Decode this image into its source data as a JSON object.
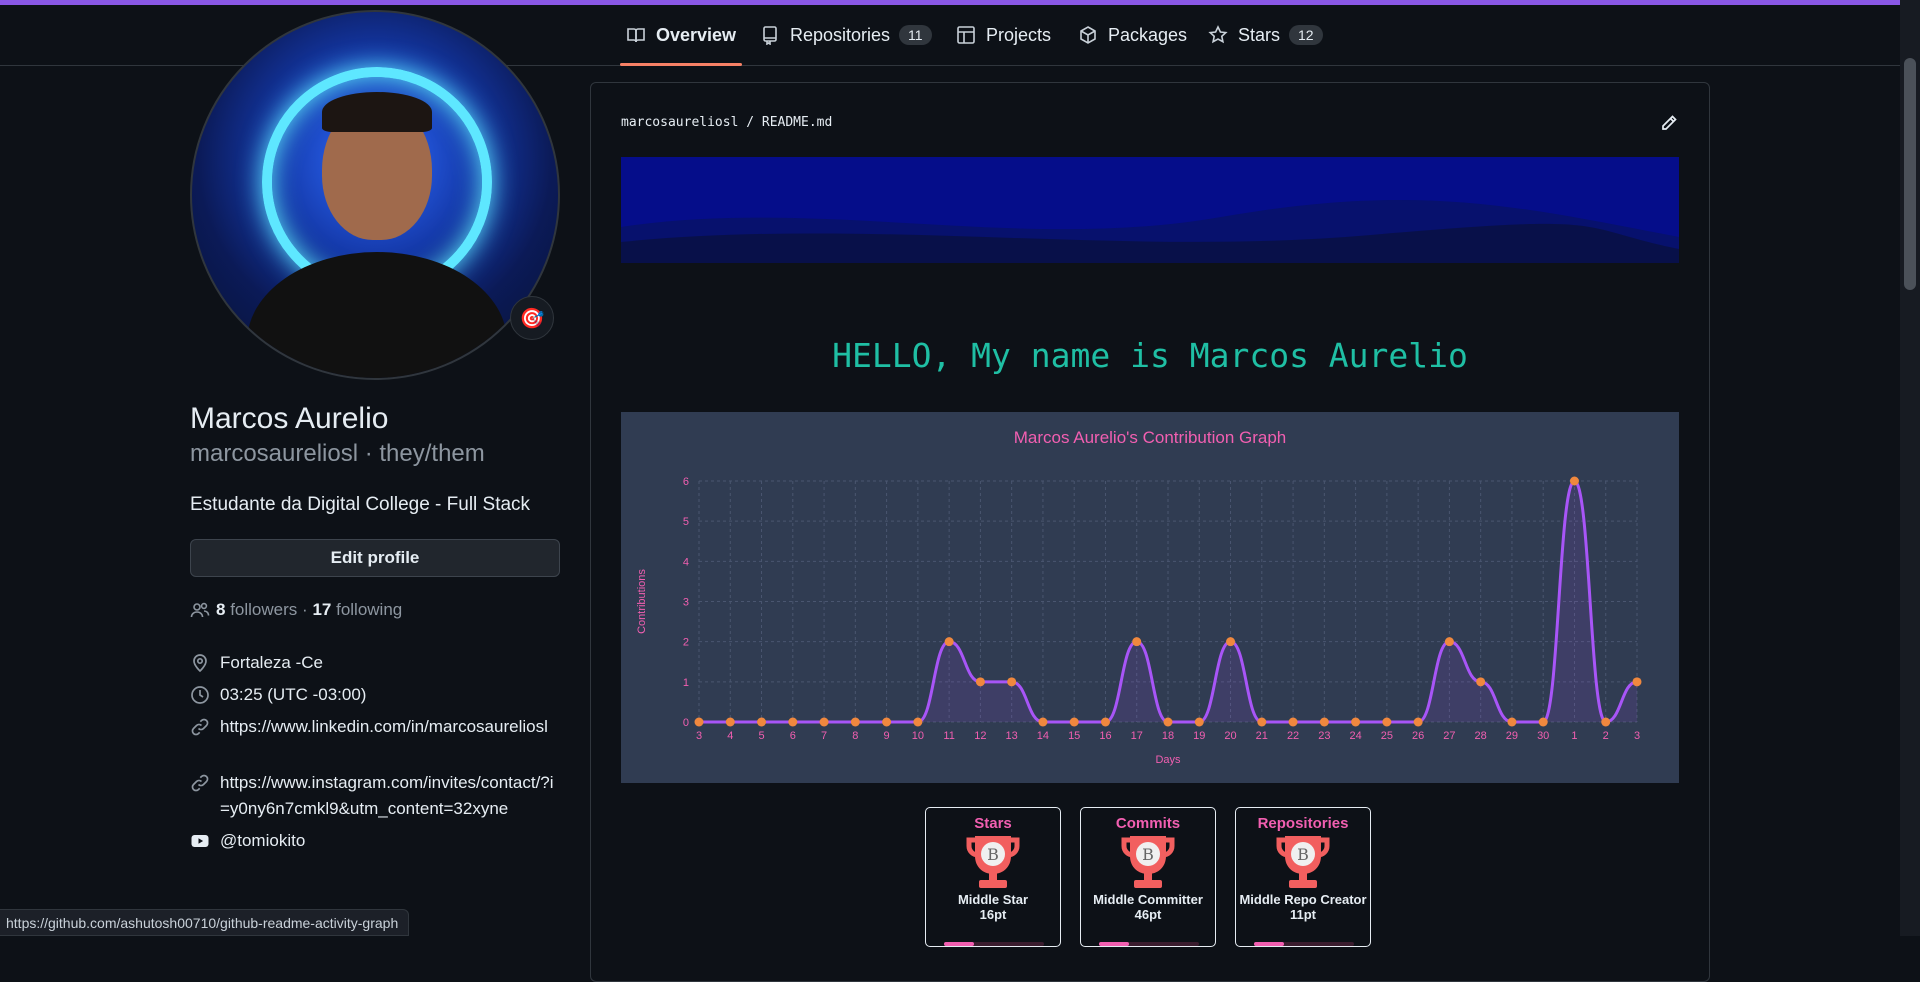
{
  "tabs": [
    {
      "label": "Overview",
      "icon": "book-icon",
      "active": true
    },
    {
      "label": "Repositories",
      "icon": "repo-icon",
      "count": "11"
    },
    {
      "label": "Projects",
      "icon": "table-icon"
    },
    {
      "label": "Packages",
      "icon": "package-icon"
    },
    {
      "label": "Stars",
      "icon": "star-icon",
      "count": "12"
    }
  ],
  "profile": {
    "name": "Marcos Aurelio",
    "login_line": "marcosaureliosl · they/them",
    "bio": "Estudante da Digital College - Full Stack",
    "edit_label": "Edit profile",
    "followers_count": "8",
    "followers_label": "followers",
    "separator": "·",
    "following_count": "17",
    "following_label": "following",
    "status_emoji": "🎯",
    "details": [
      {
        "icon": "location-icon",
        "text": "Fortaleza -Ce"
      },
      {
        "icon": "clock-icon",
        "text": "03:25 (UTC -03:00)"
      },
      {
        "icon": "link-icon",
        "text": "https://www.linkedin.com/in/marcosaureliosl"
      },
      {
        "icon": "link-icon",
        "text": "https://www.instagram.com/invites/contact/?i=y0ny6n7cmkl9&utm_content=32xyne"
      },
      {
        "icon": "youtube-icon",
        "text": "@tomiokito"
      }
    ]
  },
  "readme": {
    "path": "marcosaureliosl / README.md",
    "heading": "HELLO, My name is Marcos Aurelio",
    "trophies": [
      {
        "title": "Stars",
        "rank": "Middle Star",
        "points": "16pt",
        "letter": "B"
      },
      {
        "title": "Commits",
        "rank": "Middle Committer",
        "points": "46pt",
        "letter": "B"
      },
      {
        "title": "Repositories",
        "rank": "Middle Repo Creator",
        "points": "11pt",
        "letter": "B"
      }
    ]
  },
  "chart_data": {
    "type": "line",
    "title": "Marcos Aurelio's Contribution Graph",
    "xlabel": "Days",
    "ylabel": "Contributions",
    "x": [
      "3",
      "4",
      "5",
      "6",
      "7",
      "8",
      "9",
      "10",
      "11",
      "12",
      "13",
      "14",
      "15",
      "16",
      "17",
      "18",
      "19",
      "20",
      "21",
      "22",
      "23",
      "24",
      "25",
      "26",
      "27",
      "28",
      "29",
      "30",
      "1",
      "2",
      "3"
    ],
    "values": [
      0,
      0,
      0,
      0,
      0,
      0,
      0,
      0,
      2,
      1,
      1,
      0,
      0,
      0,
      2,
      0,
      0,
      2,
      0,
      0,
      0,
      0,
      0,
      0,
      2,
      1,
      0,
      0,
      6,
      0,
      1
    ],
    "ylim": [
      0,
      6
    ],
    "yticks": [
      0,
      1,
      2,
      3,
      4,
      5,
      6
    ],
    "grid": true,
    "colors": {
      "line": "#a855f7",
      "point": "#f0883e",
      "title": "#f25fb1",
      "axis": "#f25fb1",
      "background": "#303c52"
    }
  },
  "status_bar_url": "https://github.com/ashutosh00710/github-readme-activity-graph",
  "colors": {
    "accent": "#f78166",
    "hello": "#1fbfa4",
    "trophy": "#f25fb1"
  }
}
